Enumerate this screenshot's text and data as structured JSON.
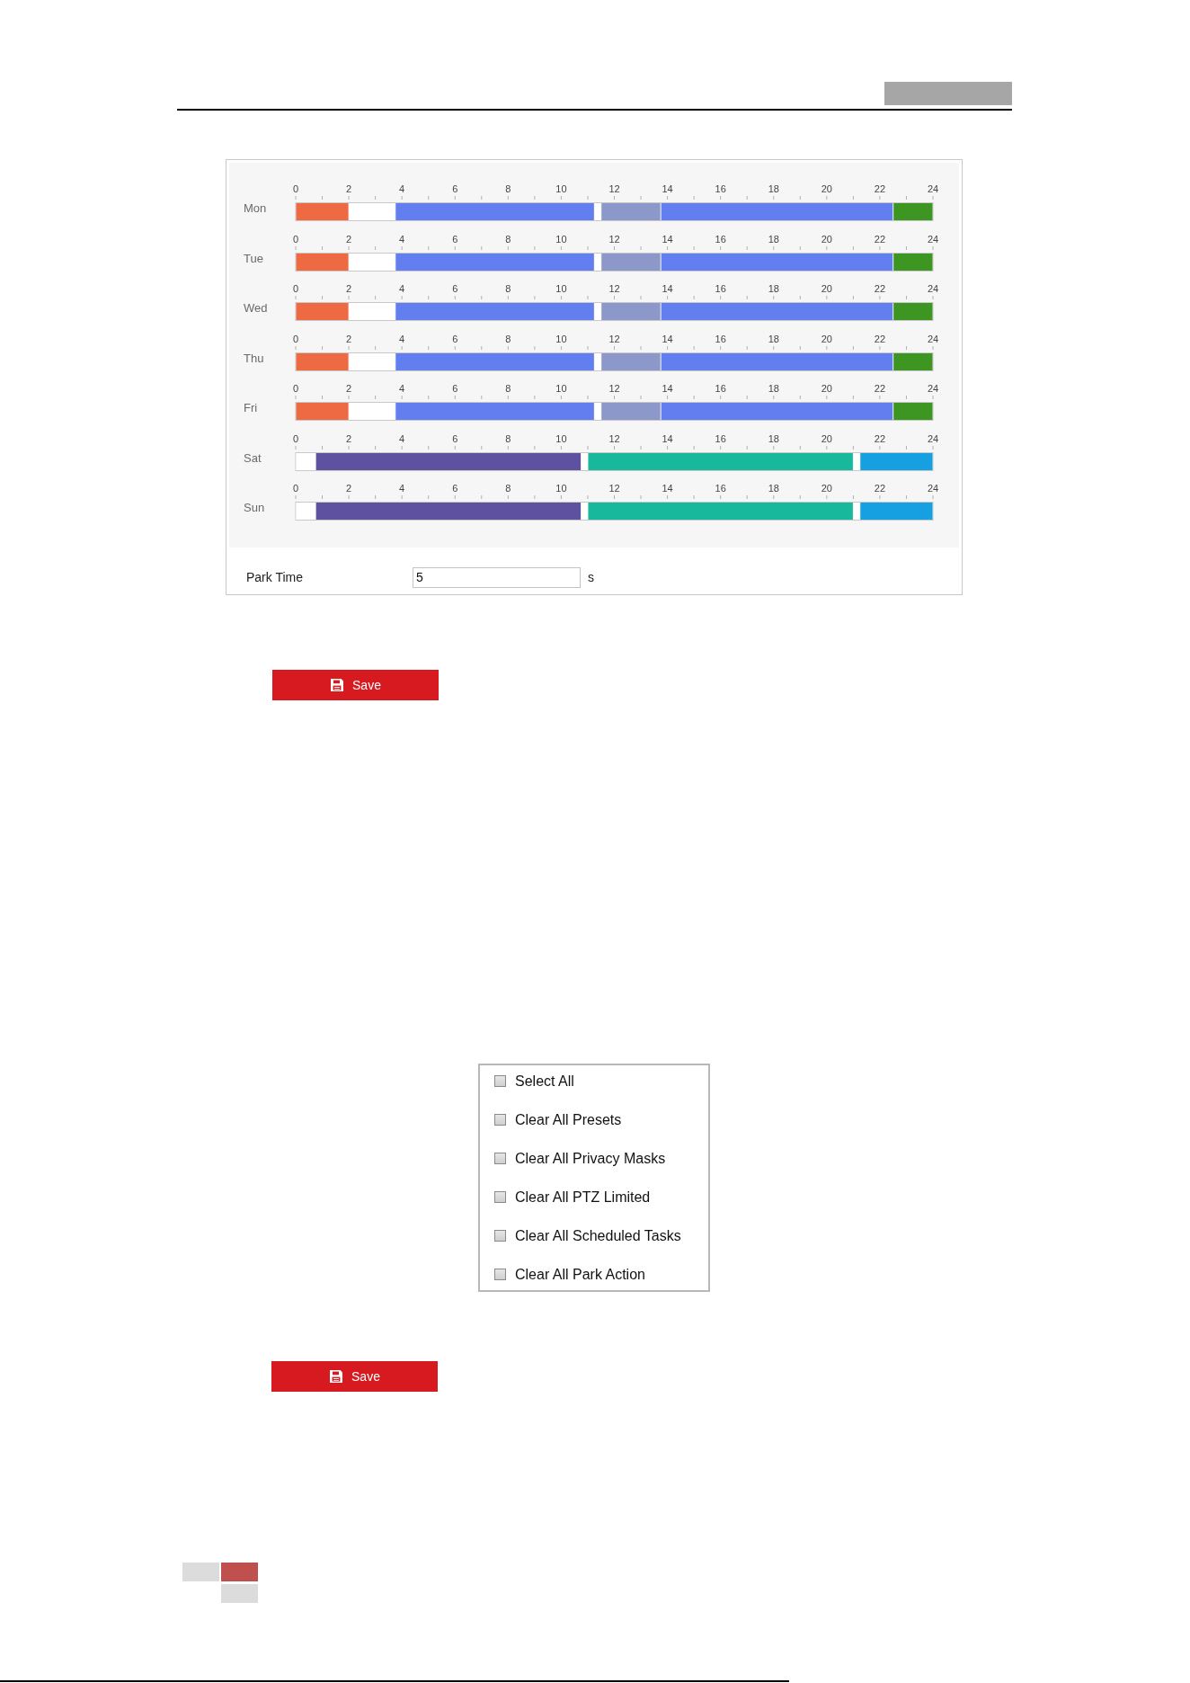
{
  "schedule_section": {
    "days": [
      {
        "chart_data": {
          "type": "bar",
          "orientation": "horizontal",
          "stacked": true,
          "categories": [
            "Mon"
          ],
          "xlim": [
            0,
            24
          ],
          "xticks": [
            0,
            2,
            4,
            6,
            8,
            10,
            12,
            14,
            16,
            18,
            20,
            22,
            24
          ],
          "series": [
            {
              "color": "#ee6a43",
              "values": [
                2
              ]
            },
            {
              "color": "#ffffff",
              "values": [
                1.75
              ]
            },
            {
              "color": "#637eee",
              "values": [
                7.5
              ]
            },
            {
              "color": "#ffffff",
              "values": [
                0.25
              ]
            },
            {
              "color": "#8c98c9",
              "values": [
                2.25
              ]
            },
            {
              "color": "#637eee",
              "values": [
                8.75
              ]
            },
            {
              "color": "#3e9622",
              "values": [
                1.5
              ]
            }
          ]
        }
      },
      {
        "chart_data": {
          "type": "bar",
          "orientation": "horizontal",
          "stacked": true,
          "categories": [
            "Tue"
          ],
          "xlim": [
            0,
            24
          ],
          "xticks": [
            0,
            2,
            4,
            6,
            8,
            10,
            12,
            14,
            16,
            18,
            20,
            22,
            24
          ],
          "series": [
            {
              "color": "#ee6a43",
              "values": [
                2
              ]
            },
            {
              "color": "#ffffff",
              "values": [
                1.75
              ]
            },
            {
              "color": "#637eee",
              "values": [
                7.5
              ]
            },
            {
              "color": "#ffffff",
              "values": [
                0.25
              ]
            },
            {
              "color": "#8c98c9",
              "values": [
                2.25
              ]
            },
            {
              "color": "#637eee",
              "values": [
                8.75
              ]
            },
            {
              "color": "#3e9622",
              "values": [
                1.5
              ]
            }
          ]
        }
      },
      {
        "chart_data": {
          "type": "bar",
          "orientation": "horizontal",
          "stacked": true,
          "categories": [
            "Wed"
          ],
          "xlim": [
            0,
            24
          ],
          "xticks": [
            0,
            2,
            4,
            6,
            8,
            10,
            12,
            14,
            16,
            18,
            20,
            22,
            24
          ],
          "series": [
            {
              "color": "#ee6a43",
              "values": [
                2
              ]
            },
            {
              "color": "#ffffff",
              "values": [
                1.75
              ]
            },
            {
              "color": "#637eee",
              "values": [
                7.5
              ]
            },
            {
              "color": "#ffffff",
              "values": [
                0.25
              ]
            },
            {
              "color": "#8c98c9",
              "values": [
                2.25
              ]
            },
            {
              "color": "#637eee",
              "values": [
                8.75
              ]
            },
            {
              "color": "#3e9622",
              "values": [
                1.5
              ]
            }
          ]
        }
      },
      {
        "chart_data": {
          "type": "bar",
          "orientation": "horizontal",
          "stacked": true,
          "categories": [
            "Thu"
          ],
          "xlim": [
            0,
            24
          ],
          "xticks": [
            0,
            2,
            4,
            6,
            8,
            10,
            12,
            14,
            16,
            18,
            20,
            22,
            24
          ],
          "series": [
            {
              "color": "#ee6a43",
              "values": [
                2
              ]
            },
            {
              "color": "#ffffff",
              "values": [
                1.75
              ]
            },
            {
              "color": "#637eee",
              "values": [
                7.5
              ]
            },
            {
              "color": "#ffffff",
              "values": [
                0.25
              ]
            },
            {
              "color": "#8c98c9",
              "values": [
                2.25
              ]
            },
            {
              "color": "#637eee",
              "values": [
                8.75
              ]
            },
            {
              "color": "#3e9622",
              "values": [
                1.5
              ]
            }
          ]
        }
      },
      {
        "chart_data": {
          "type": "bar",
          "orientation": "horizontal",
          "stacked": true,
          "categories": [
            "Fri"
          ],
          "xlim": [
            0,
            24
          ],
          "xticks": [
            0,
            2,
            4,
            6,
            8,
            10,
            12,
            14,
            16,
            18,
            20,
            22,
            24
          ],
          "series": [
            {
              "color": "#ee6a43",
              "values": [
                2
              ]
            },
            {
              "color": "#ffffff",
              "values": [
                1.75
              ]
            },
            {
              "color": "#637eee",
              "values": [
                7.5
              ]
            },
            {
              "color": "#ffffff",
              "values": [
                0.25
              ]
            },
            {
              "color": "#8c98c9",
              "values": [
                2.25
              ]
            },
            {
              "color": "#637eee",
              "values": [
                8.75
              ]
            },
            {
              "color": "#3e9622",
              "values": [
                1.5
              ]
            }
          ]
        }
      },
      {
        "chart_data": {
          "type": "bar",
          "orientation": "horizontal",
          "stacked": true,
          "categories": [
            "Sat"
          ],
          "xlim": [
            0,
            24
          ],
          "xticks": [
            0,
            2,
            4,
            6,
            8,
            10,
            12,
            14,
            16,
            18,
            20,
            22,
            24
          ],
          "series": [
            {
              "color": "#ffffff",
              "values": [
                0.75
              ]
            },
            {
              "color": "#5e51a0",
              "values": [
                10
              ]
            },
            {
              "color": "#ffffff",
              "values": [
                0.25
              ]
            },
            {
              "color": "#17b89c",
              "values": [
                10
              ]
            },
            {
              "color": "#ffffff",
              "values": [
                0.25
              ]
            },
            {
              "color": "#16a0e1",
              "values": [
                2.75
              ]
            }
          ]
        }
      },
      {
        "chart_data": {
          "type": "bar",
          "orientation": "horizontal",
          "stacked": true,
          "categories": [
            "Sun"
          ],
          "xlim": [
            0,
            24
          ],
          "xticks": [
            0,
            2,
            4,
            6,
            8,
            10,
            12,
            14,
            16,
            18,
            20,
            22,
            24
          ],
          "series": [
            {
              "color": "#ffffff",
              "values": [
                0.75
              ]
            },
            {
              "color": "#5e51a0",
              "values": [
                10
              ]
            },
            {
              "color": "#ffffff",
              "values": [
                0.25
              ]
            },
            {
              "color": "#17b89c",
              "values": [
                10
              ]
            },
            {
              "color": "#ffffff",
              "values": [
                0.25
              ]
            },
            {
              "color": "#16a0e1",
              "values": [
                2.75
              ]
            }
          ]
        }
      }
    ],
    "park_time": {
      "label": "Park Time",
      "value": "5",
      "unit": "s"
    },
    "save_button": {
      "label": "Save"
    }
  },
  "clear_section": {
    "options": [
      {
        "label": "Select All",
        "checked": false
      },
      {
        "label": "Clear All Presets",
        "checked": false
      },
      {
        "label": "Clear All Privacy Masks",
        "checked": false
      },
      {
        "label": "Clear All PTZ Limited",
        "checked": false
      },
      {
        "label": "Clear All Scheduled Tasks",
        "checked": false
      },
      {
        "label": "Clear All Park Action",
        "checked": false
      }
    ],
    "save_button": {
      "label": "Save"
    }
  }
}
